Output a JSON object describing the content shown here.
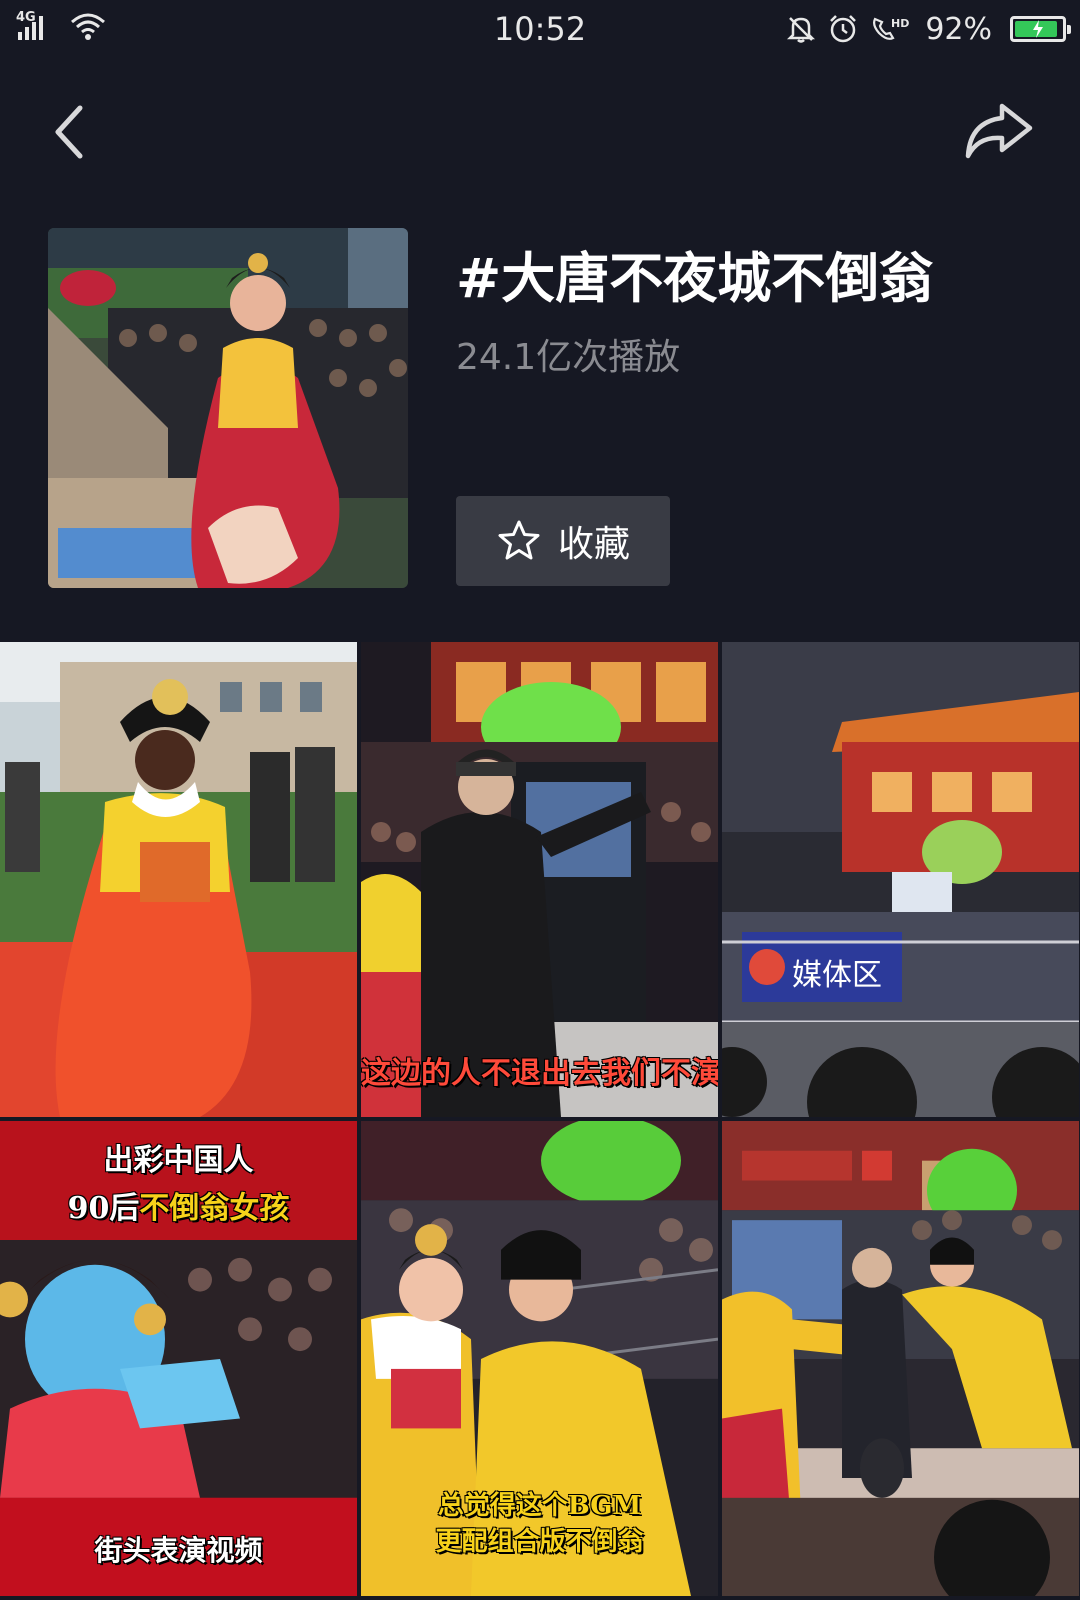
{
  "status_bar": {
    "network": "4G",
    "time": "10:52",
    "battery_percent": "92%",
    "battery_level": 0.92,
    "icons": [
      "signal-icon",
      "wifi-icon",
      "bell-muted-icon",
      "alarm-icon",
      "hd-call-icon",
      "battery-charging-icon"
    ]
  },
  "nav": {
    "back_icon": "chevron-left-icon",
    "share_icon": "share-arrow-icon"
  },
  "topic": {
    "title": "#大唐不夜城不倒翁",
    "play_count": "24.1亿次播放",
    "favorite_label": "收藏"
  },
  "colors": {
    "background": "#161823",
    "button_bg": "#393b44",
    "muted_text": "#8a8b91",
    "battery_green": "#34c759"
  },
  "videos": [
    {
      "caption": ""
    },
    {
      "caption": "这边的人不退出去我们不演出"
    },
    {
      "caption": "媒体区"
    },
    {
      "caption_top": "出彩中国人",
      "caption_mid_prefix": "90后",
      "caption_mid_highlight": "不倒翁女孩",
      "caption_bottom": "街头表演视频"
    },
    {
      "caption_line1": "总觉得这个BGM",
      "caption_line2": "更配组合版不倒翁"
    },
    {
      "caption": ""
    }
  ]
}
